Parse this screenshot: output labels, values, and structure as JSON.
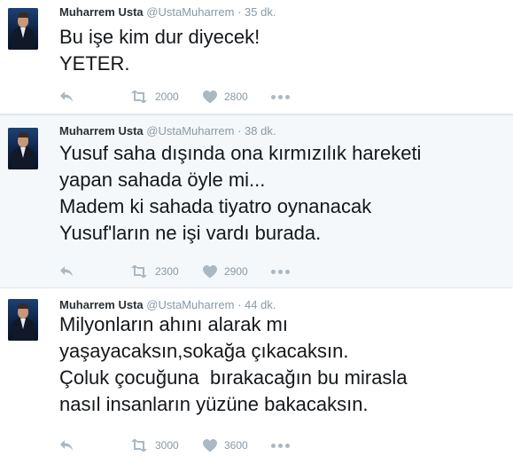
{
  "tweets": [
    {
      "name": "Muharrem Usta",
      "handle": "@UstaMuharrem",
      "separator": "·",
      "time": "35 dk.",
      "lines": [
        "Bu işe kim dur diyecek!",
        "YETER."
      ],
      "retweets": "2000",
      "likes": "2800"
    },
    {
      "name": "Muharrem Usta",
      "handle": "@UstaMuharrem",
      "separator": "·",
      "time": "38 dk.",
      "lines": [
        "Yusuf saha dışında ona kırmızılık hareketi",
        "yapan sahada öyle mi...",
        "Madem ki sahada tiyatro oynanacak",
        "Yusuf'ların ne işi vardı burada."
      ],
      "retweets": "2300",
      "likes": "2900"
    },
    {
      "name": "Muharrem Usta",
      "handle": "@UstaMuharrem",
      "separator": "·",
      "time": "44 dk.",
      "lines": [
        "Milyonların ahını alarak mı",
        "yaşayacaksın,sokağa çıkacaksın.",
        "Çoluk çocuğuna  bırakacağın bu mirasla",
        "nasıl insanların yüzüne bakacaksın."
      ],
      "retweets": "3000",
      "likes": "3600"
    }
  ],
  "icons": {
    "reply": "reply-arrow-icon",
    "retweet": "retweet-icon",
    "like": "heart-icon",
    "more": "more-dots-icon"
  },
  "colors": {
    "text": "#14171a",
    "meta": "#8899a6",
    "icon": "#aab8c2",
    "highlight_bg": "#f5f8fa",
    "divider": "#e1e8ed"
  }
}
